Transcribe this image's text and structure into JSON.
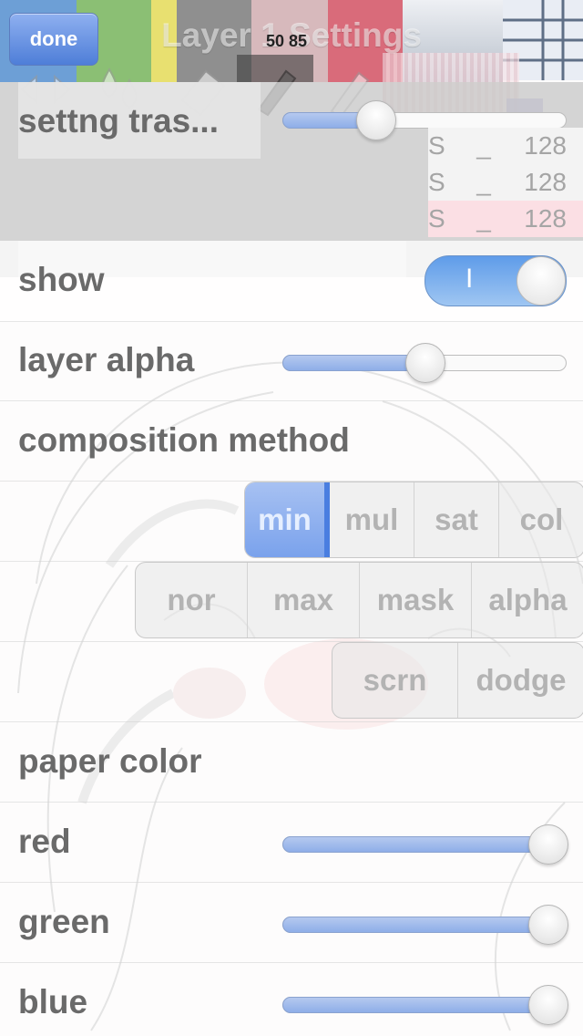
{
  "nav": {
    "title": "Layer 1 Settings",
    "done_label": "done",
    "zoom_readout": "50 85"
  },
  "colors": {
    "accent": "#5f9ce9",
    "label_text": "#6a6a6a",
    "palette": [
      "#6d9fd6",
      "#8bbf74",
      "#e8e070",
      "#8f8f8f",
      "#d7b9bc",
      "#d96b7a",
      "#dfe3ea"
    ]
  },
  "icons": {
    "arrows": "arrows-icon",
    "drops": "drops-icon",
    "eraser": "eraser-icon",
    "pen": "pen-icon",
    "pencil": "pencil-icon",
    "grid": "grid-icon"
  },
  "brush": {
    "label": "settng tras...",
    "transparency": 0.3
  },
  "swatches": [
    {
      "mode": "S",
      "sep": "_",
      "value": "128"
    },
    {
      "mode": "S",
      "sep": "_",
      "value": "128"
    },
    {
      "mode": "S",
      "sep": "_",
      "value": "128",
      "selected": true
    }
  ],
  "rows": {
    "show": {
      "label": "show",
      "state": "I",
      "on": true
    },
    "layer_alpha": {
      "label": "layer alpha",
      "value": 0.5
    },
    "composition_method": {
      "label": "composition method"
    },
    "paper_color": {
      "label": "paper color"
    },
    "red": {
      "label": "red",
      "value": 1.0
    },
    "green": {
      "label": "green",
      "value": 1.0
    },
    "blue": {
      "label": "blue",
      "value": 1.0
    }
  },
  "composition": {
    "selected": "min",
    "row1": [
      "min",
      "mul",
      "sat",
      "col"
    ],
    "row2": [
      "nor",
      "max",
      "mask",
      "alpha"
    ],
    "row3": [
      "scrn",
      "dodge"
    ]
  }
}
